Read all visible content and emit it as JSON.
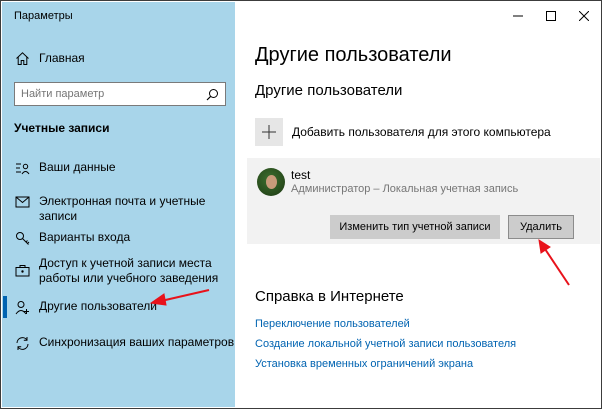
{
  "window": {
    "title": "Параметры"
  },
  "controls": {
    "minimize": "—",
    "maximize": "☐",
    "close": "✕"
  },
  "sidebar": {
    "home_label": "Главная",
    "search_placeholder": "Найти параметр",
    "section_heading": "Учетные записи",
    "items": [
      {
        "label": "Ваши данные",
        "icon": "contact-card-icon",
        "active": false
      },
      {
        "label": "Электронная почта и учетные записи",
        "icon": "mail-icon",
        "active": false
      },
      {
        "label": "Варианты входа",
        "icon": "key-icon",
        "active": false
      },
      {
        "label": "Доступ к учетной записи места работы или учебного заведения",
        "icon": "briefcase-icon",
        "active": false
      },
      {
        "label": "Другие пользователи",
        "icon": "person-add-icon",
        "active": true
      },
      {
        "label": "Синхронизация ваших параметров",
        "icon": "sync-icon",
        "active": false
      }
    ]
  },
  "main": {
    "title": "Другие пользователи",
    "subtitle": "Другие пользователи",
    "add_user_label": "Добавить пользователя для этого компьютера",
    "user": {
      "name": "test",
      "role": "Администратор – Локальная учетная запись",
      "change_type_label": "Изменить тип учетной записи",
      "delete_label": "Удалить"
    },
    "help": {
      "title": "Справка в Интернете",
      "links": [
        "Переключение пользователей",
        "Создание локальной учетной записи пользователя",
        "Установка временных ограничений экрана"
      ]
    }
  },
  "colors": {
    "sidebar_bg": "#a8d5ea",
    "accent": "#0063b1",
    "annotation_arrow": "#e8121b"
  }
}
